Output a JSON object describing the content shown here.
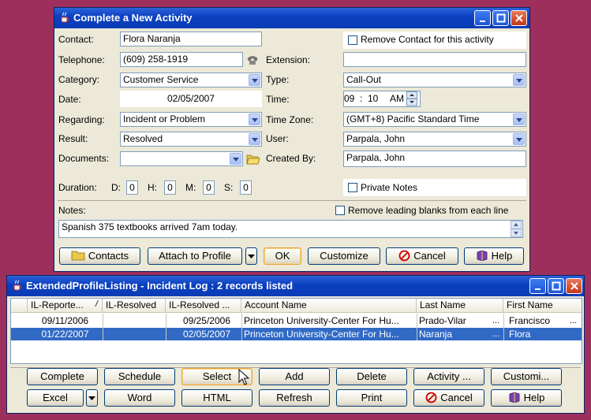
{
  "activity_window": {
    "title": "Complete a New Activity",
    "contact_label": "Contact:",
    "contact_value": "Flora Naranja",
    "remove_contact_label": "Remove Contact for this activity",
    "telephone_label": "Telephone:",
    "telephone_value": "(609) 258-1919",
    "extension_label": "Extension:",
    "extension_value": "",
    "category_label": "Category:",
    "category_value": "Customer Service",
    "type_label": "Type:",
    "type_value": "Call-Out",
    "date_label": "Date:",
    "date_value": "02/05/2007",
    "time_label": "Time:",
    "time_hour": "09",
    "time_sep": ":",
    "time_min": "10",
    "time_ampm": "AM",
    "regarding_label": "Regarding:",
    "regarding_value": "Incident or Problem",
    "timezone_label": "Time Zone:",
    "timezone_value": "(GMT+8) Pacific Standard Time",
    "result_label": "Result:",
    "result_value": "Resolved",
    "user_label": "User:",
    "user_value": "Parpala, John",
    "documents_label": "Documents:",
    "documents_value": "",
    "created_by_label": "Created By:",
    "created_by_value": "Parpala, John",
    "duration_label": "Duration:",
    "d_label": "D:",
    "d_value": "0",
    "h_label": "H:",
    "h_value": "0",
    "m_label": "M:",
    "m_value": "0",
    "s_label": "S:",
    "s_value": "0",
    "private_notes_label": "Private Notes",
    "notes_label": "Notes:",
    "remove_blanks_label": "Remove leading blanks from each line",
    "notes_value": "Spanish 375 textbooks arrived 7am today.",
    "buttons": {
      "contacts": "Contacts",
      "attach": "Attach to Profile",
      "ok": "OK",
      "customize": "Customize",
      "cancel": "Cancel",
      "help": "Help"
    }
  },
  "listing_window": {
    "title": "ExtendedProfileListing - Incident Log : 2 records listed",
    "columns": [
      "IL-Reporte...",
      "IL-Resolved",
      "IL-Resolved ...",
      "Account Name",
      "Last Name",
      "First Name"
    ],
    "sort_indicator": "/",
    "rows": [
      [
        "09/11/2006",
        "",
        "09/25/2006",
        "Princeton University-Center For Hu...",
        "Prado-Vilar",
        "Francisco"
      ],
      [
        "01/22/2007",
        "",
        "02/05/2007",
        "Princeton University-Center For Hu...",
        "Naranja",
        "Flora"
      ]
    ],
    "ellipsis": "...",
    "buttons": {
      "complete": "Complete",
      "schedule": "Schedule",
      "select": "Select",
      "add": "Add",
      "delete": "Delete",
      "activity": "Activity ...",
      "customize": "Customi...",
      "excel": "Excel",
      "word": "Word",
      "html": "HTML",
      "refresh": "Refresh",
      "print": "Print",
      "cancel": "Cancel",
      "help": "Help"
    }
  },
  "colors": {
    "desktop": "#9c2f5c",
    "titlebar": "#0a3fbf",
    "selection": "#316ac5"
  }
}
